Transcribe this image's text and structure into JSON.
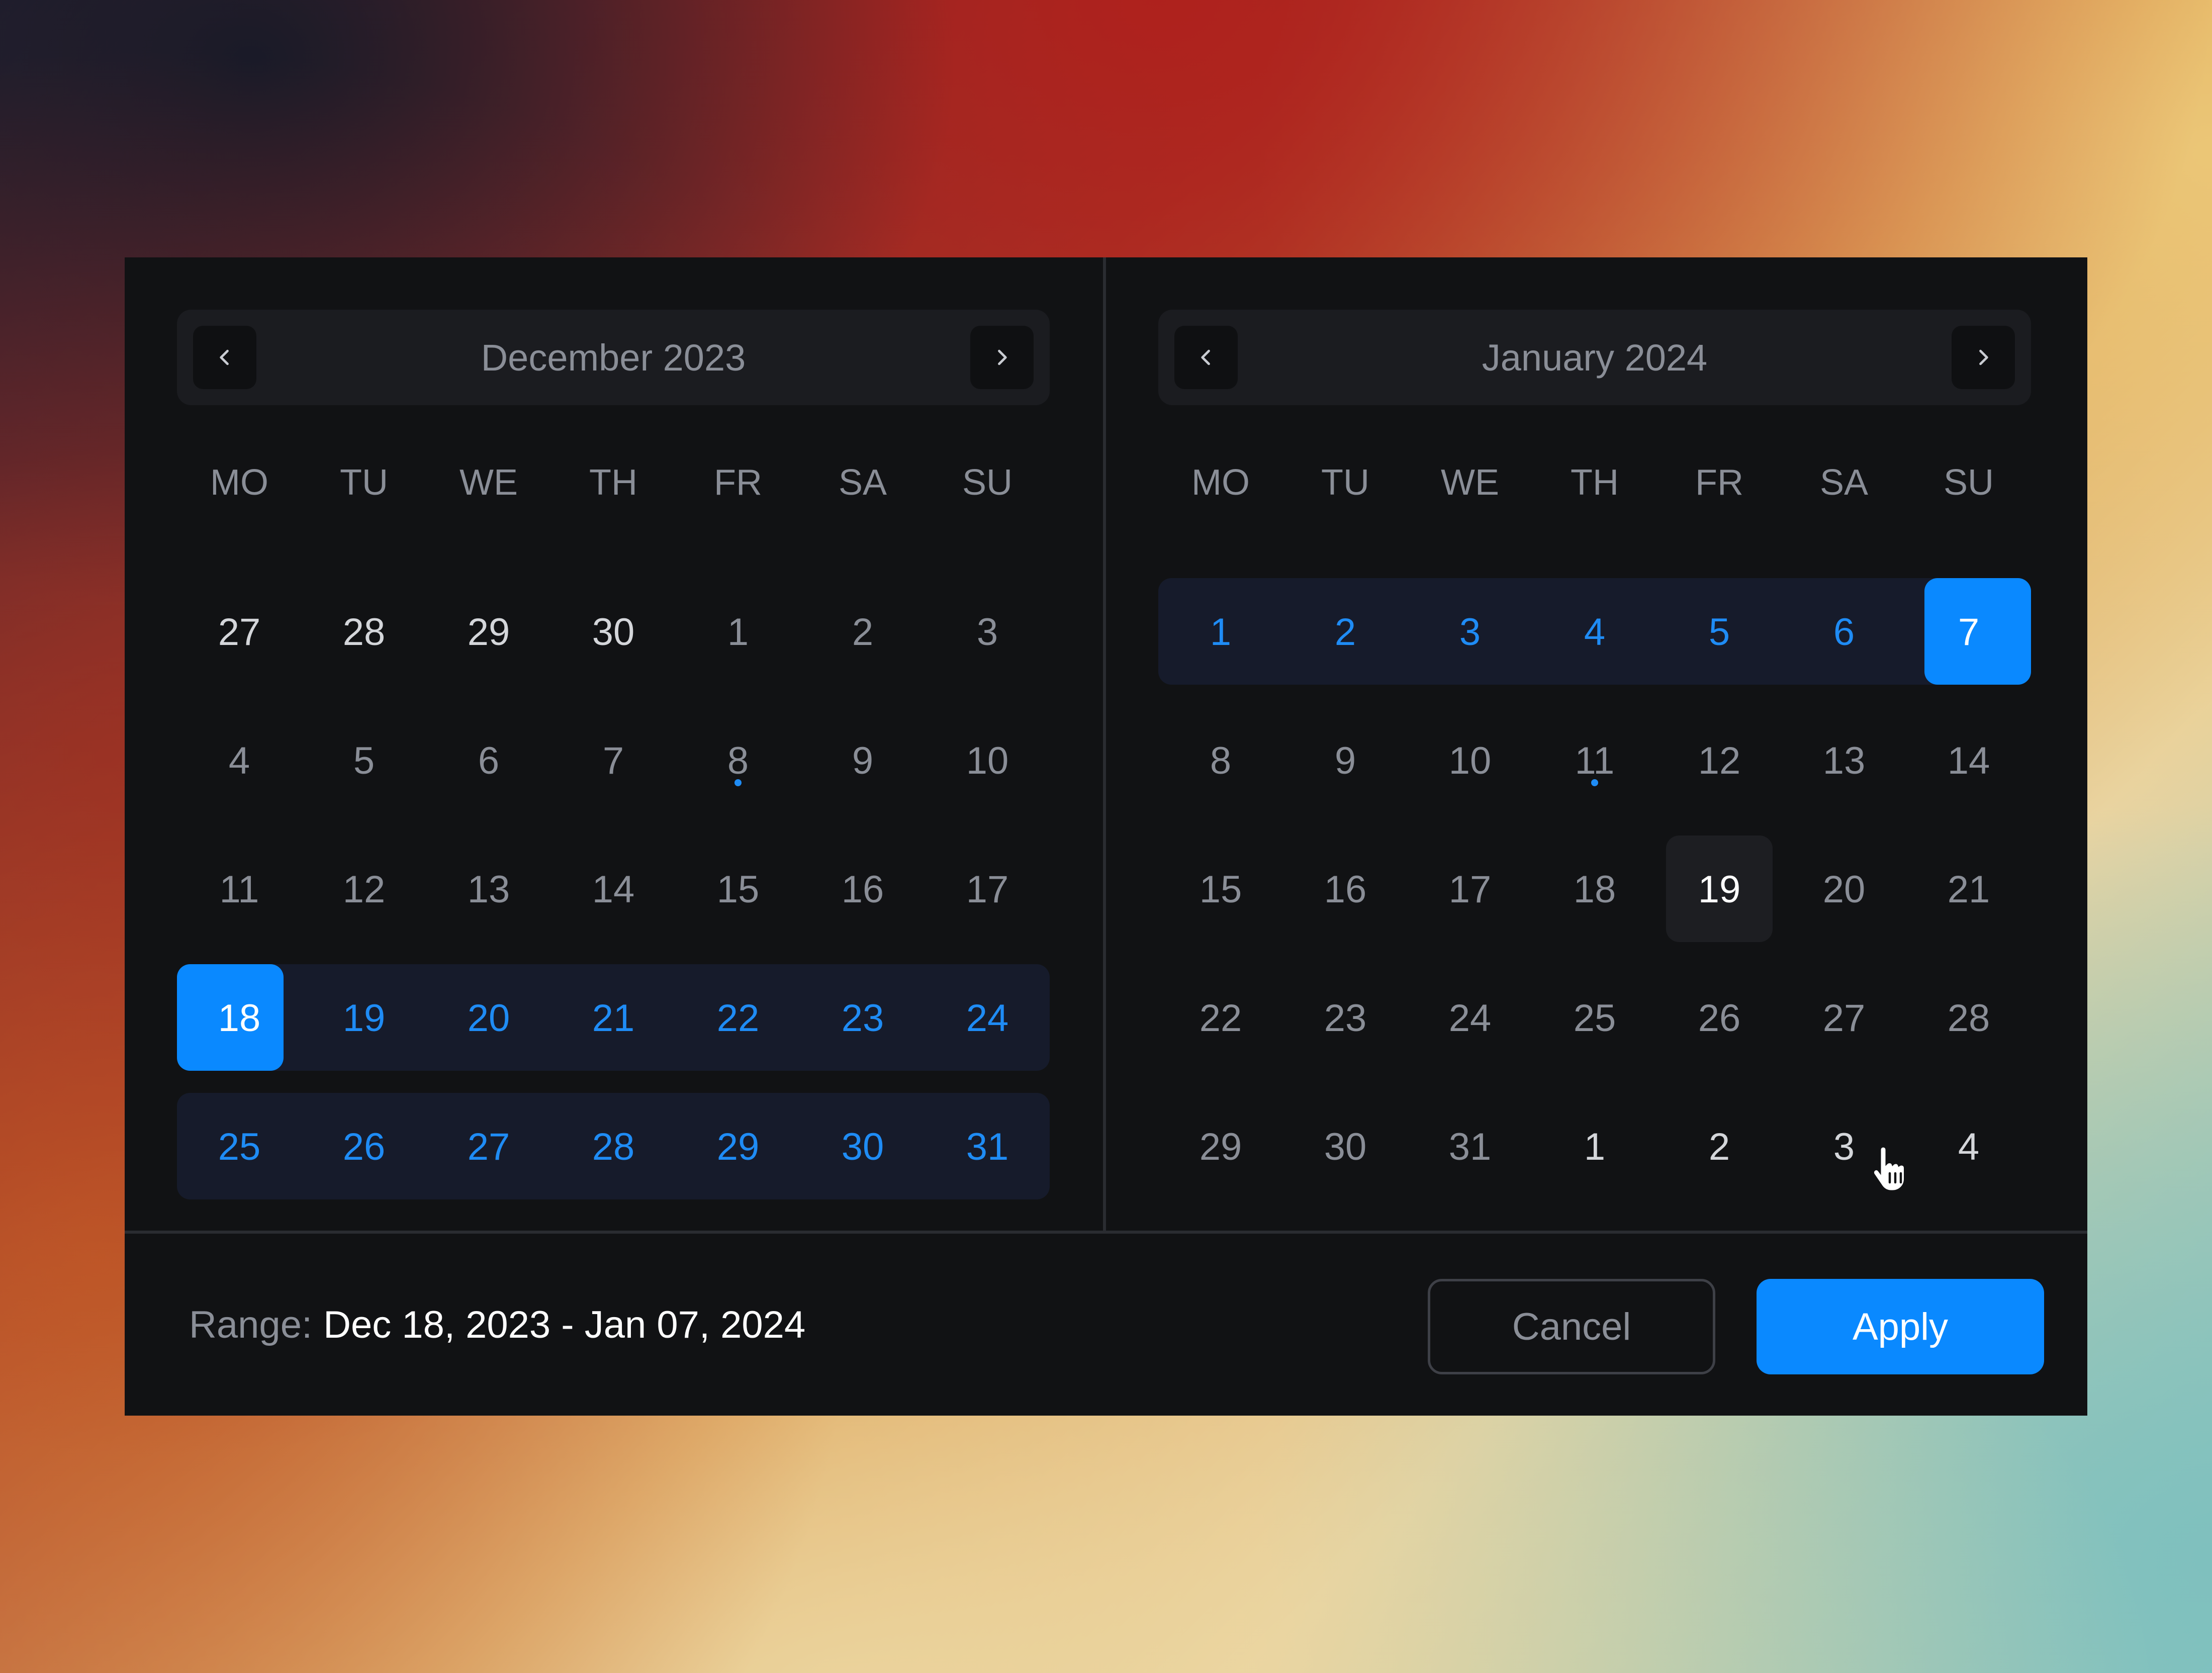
{
  "colors": {
    "accent": "#0a89ff",
    "range_text": "#1f8cf5",
    "range_band": "#161b2b",
    "panel_bg": "#111214"
  },
  "months": [
    {
      "title": "December 2023",
      "prev_icon": "chevron-left-icon",
      "next_icon": "chevron-right-icon",
      "weekdays": [
        "MO",
        "TU",
        "WE",
        "TH",
        "FR",
        "SA",
        "SU"
      ],
      "weeks": [
        [
          "27",
          "28",
          "29",
          "30",
          "1",
          "2",
          "3"
        ],
        [
          "4",
          "5",
          "6",
          "7",
          "8",
          "9",
          "10"
        ],
        [
          "11",
          "12",
          "13",
          "14",
          "15",
          "16",
          "17"
        ],
        [
          "18",
          "19",
          "20",
          "21",
          "22",
          "23",
          "24"
        ],
        [
          "25",
          "26",
          "27",
          "28",
          "29",
          "30",
          "31"
        ]
      ]
    },
    {
      "title": "January 2024",
      "prev_icon": "chevron-left-icon",
      "next_icon": "chevron-right-icon",
      "weekdays": [
        "MO",
        "TU",
        "WE",
        "TH",
        "FR",
        "SA",
        "SU"
      ],
      "weeks": [
        [
          "1",
          "2",
          "3",
          "4",
          "5",
          "6",
          "7"
        ],
        [
          "8",
          "9",
          "10",
          "11",
          "12",
          "13",
          "14"
        ],
        [
          "15",
          "16",
          "17",
          "18",
          "19",
          "20",
          "21"
        ],
        [
          "22",
          "23",
          "24",
          "25",
          "26",
          "27",
          "28"
        ],
        [
          "29",
          "30",
          "31",
          "1",
          "2",
          "3",
          "4"
        ]
      ]
    }
  ],
  "footer": {
    "range_label": "Range:",
    "range_value": "Dec 18, 2023 - Jan 07, 2024",
    "cancel_label": "Cancel",
    "apply_label": "Apply"
  }
}
